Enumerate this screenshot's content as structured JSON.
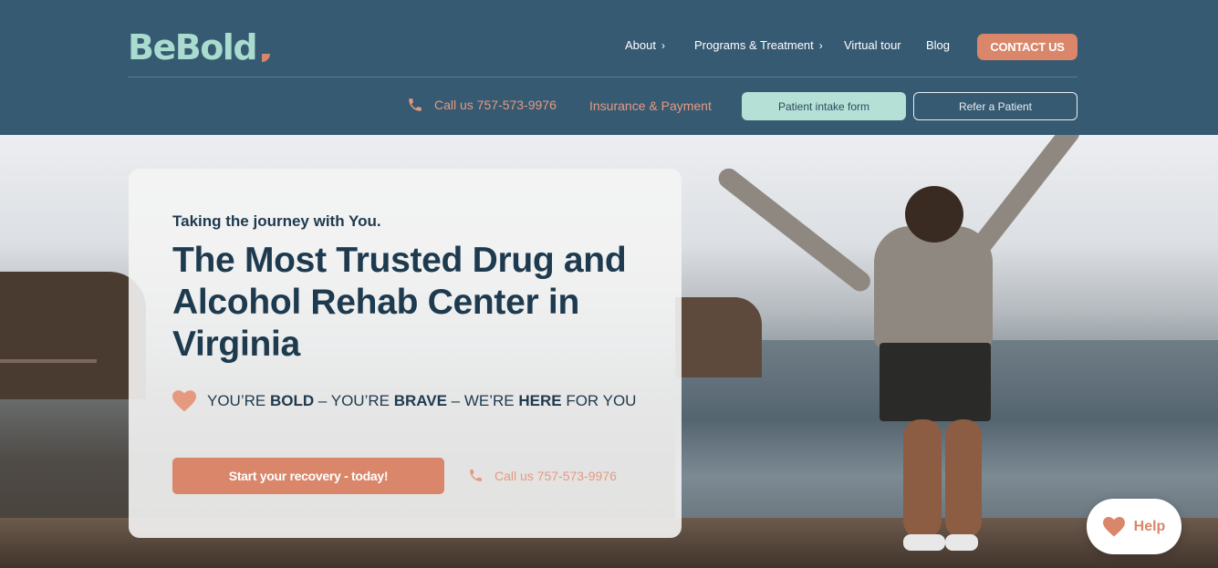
{
  "brand": {
    "name": "BeBold",
    "accent": "#d9866a",
    "header_bg": "#365a72",
    "logo_color": "#a9dccf",
    "text_dark": "#1e3a4e"
  },
  "nav": {
    "items": [
      {
        "label": "About",
        "has_chevron": true
      },
      {
        "label": "Programs & Treatment",
        "has_chevron": true
      },
      {
        "label": "Virtual tour",
        "has_chevron": false
      },
      {
        "label": "Blog",
        "has_chevron": false
      }
    ],
    "contact_label": "CONTACT US"
  },
  "subnav": {
    "phone_label": "Call us 757-573-9976",
    "insurance_label": "Insurance & Payment",
    "intake_label": "Patient intake form",
    "refer_label": "Refer a Patient"
  },
  "hero": {
    "tagline": "Taking the journey with You.",
    "headline": "The Most Trusted Drug and Alcohol Rehab Center in Virginia",
    "bold_line": {
      "part1": "YOU’RE ",
      "bold1": "BOLD",
      "part2": " – YOU’RE ",
      "bold2": "BRAVE",
      "part3": " – WE’RE ",
      "bold3": "HERE",
      "part4": " FOR YOU"
    },
    "cta_label": "Start your recovery - today!",
    "phone_label": "Call us 757-573-9976"
  },
  "help": {
    "label": "Help",
    "icon": "heart-icon"
  }
}
